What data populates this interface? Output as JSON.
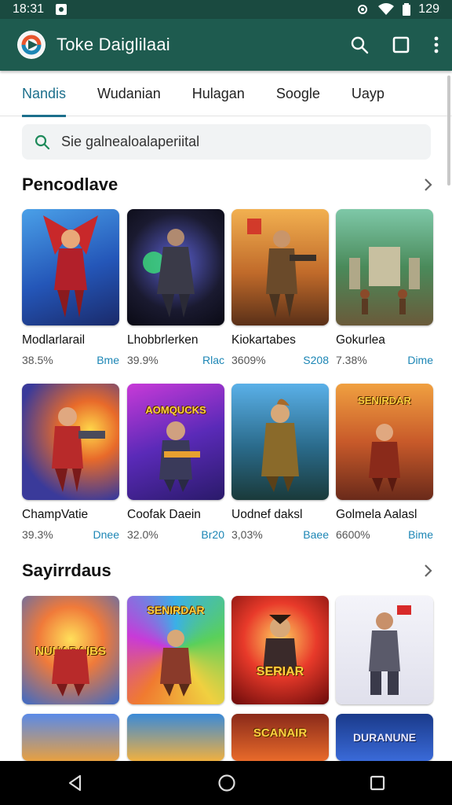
{
  "status": {
    "time": "18:31",
    "battery": "129"
  },
  "app_bar": {
    "title": "Toke Daiglilaai"
  },
  "tabs": [
    "Nandis",
    "Wudanian",
    "Hulagan",
    "Soogle",
    "Uayp"
  ],
  "search": {
    "placeholder": "Sie galnealoalaperiital"
  },
  "sections": [
    {
      "title": "Pencodlave",
      "rows": [
        [
          {
            "title": "Modlarlarail",
            "rating": "38.5%",
            "price": "Bme"
          },
          {
            "title": "Lhobbrlerken",
            "rating": "39.9%",
            "price": "Rlac"
          },
          {
            "title": "Kiokartabes",
            "rating": "3609%",
            "price": "S208"
          },
          {
            "title": "Gokurlea",
            "rating": "7.38%",
            "price": "Dime"
          }
        ],
        [
          {
            "title": "ChampVatie",
            "rating": "39.3%",
            "price": "Dnee"
          },
          {
            "title": "Coofak Daein",
            "rating": "32.0%",
            "price": "Br20"
          },
          {
            "title": "Uodnef daksl",
            "rating": "3,03%",
            "price": "Baee"
          },
          {
            "title": "Golmela Aalasl",
            "rating": "6600%",
            "price": "Bime"
          }
        ]
      ]
    },
    {
      "title": "Sayirrdaus",
      "rows": [
        [
          {
            "banner": "NUNARAIBS"
          },
          {
            "banner": "SENIRDAR"
          },
          {
            "banner": "SERIAR"
          },
          {
            "banner": ""
          }
        ],
        [
          {
            "banner": ""
          },
          {
            "banner": ""
          },
          {
            "banner": "SCANAIR"
          },
          {
            "banner": "DURANUNE"
          }
        ]
      ]
    }
  ],
  "colors": {
    "app_bar": "#1e5b4f",
    "status_bar": "#1a4a40",
    "accent": "#1c6f8c",
    "price": "#1c86b5"
  }
}
